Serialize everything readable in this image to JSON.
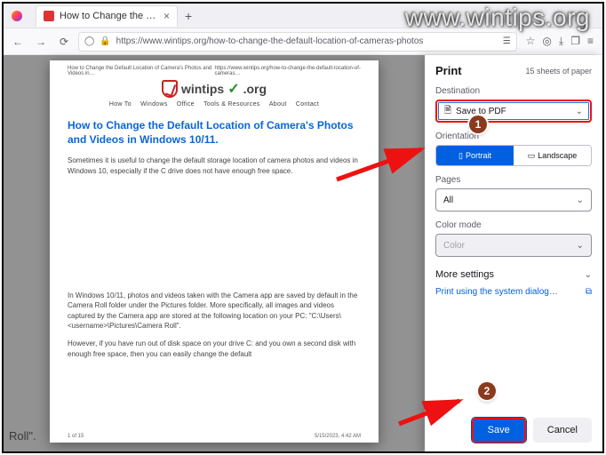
{
  "watermark": "www.wintips.org",
  "browser": {
    "tab_title": "How to Change the Default Lo",
    "url": "https://www.wintips.org/how-to-change-the-default-location-of-cameras-photos"
  },
  "preview": {
    "header_left": "How to Change the Default Location of Camera's Photos and Videos in…",
    "header_right": "https://www.wintips.org/how-to-change-the-default-location-of-cameras…",
    "site_name": "wintips",
    "site_tld": ".org",
    "menu": {
      "home": "How To",
      "windows": "Windows",
      "office": "Office",
      "tools": "Tools & Resources",
      "about": "About",
      "contact": "Contact"
    },
    "article_title": "How to Change the Default Location of Camera's Photos and Videos in Windows 10/11.",
    "para1": "Sometimes it is useful to change the default storage location of camera photos and videos in Windows 10, especially if the C drive does not have enough free space.",
    "para2": "In Windows 10/11, photos and videos taken with the Camera app are saved by default in the Camera Roll folder under the Pictures folder. More specifically, all images and videos captured by the Camera app are stored at the following location on your PC: \"C:\\Users\\<username>\\Pictures\\Camera Roll\".",
    "para3": "However, if you have run out of disk space on your drive C: and you own a second disk with enough free space, then you can easily change the default",
    "footer_left": "1 of 15",
    "footer_right": "5/15/2023, 4:42 AM"
  },
  "underlay": "Roll\".",
  "panel": {
    "title": "Print",
    "sheets": "15 sheets of paper",
    "destination_label": "Destination",
    "destination_value": "Save to PDF",
    "orientation_label": "Orientation",
    "orientation_portrait": "Portrait",
    "orientation_landscape": "Landscape",
    "pages_label": "Pages",
    "pages_value": "All",
    "color_label": "Color mode",
    "color_value": "Color",
    "more": "More settings",
    "system": "Print using the system dialog…",
    "save": "Save",
    "cancel": "Cancel"
  },
  "callouts": {
    "one": "1",
    "two": "2"
  }
}
